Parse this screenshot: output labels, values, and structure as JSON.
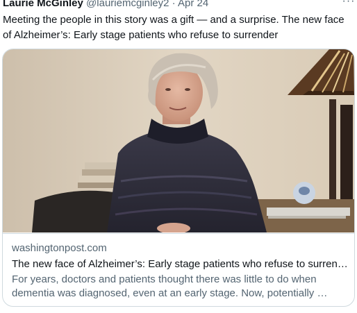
{
  "tweet": {
    "author_name": "Laurie McGinley",
    "author_handle": "@lauriemcginley2",
    "separator": "·",
    "date": "Apr 24",
    "more_icon": "more-horizontal-icon",
    "text": "Meeting the people in this story was a gift — and a surprise. The new face of Alzheimer’s: Early stage patients who refuse to surrender"
  },
  "card": {
    "domain": "washingtonpost.com",
    "title": "The new face of Alzheimer’s: Early stage patients who refuse to surrender",
    "description": "For years, doctors and patients thought there was little to do when dementia was diagnosed, even at an early stage. Now, potentially …"
  },
  "colors": {
    "text_primary": "#0f1419",
    "text_secondary": "#536471",
    "border": "#cfd9de"
  }
}
